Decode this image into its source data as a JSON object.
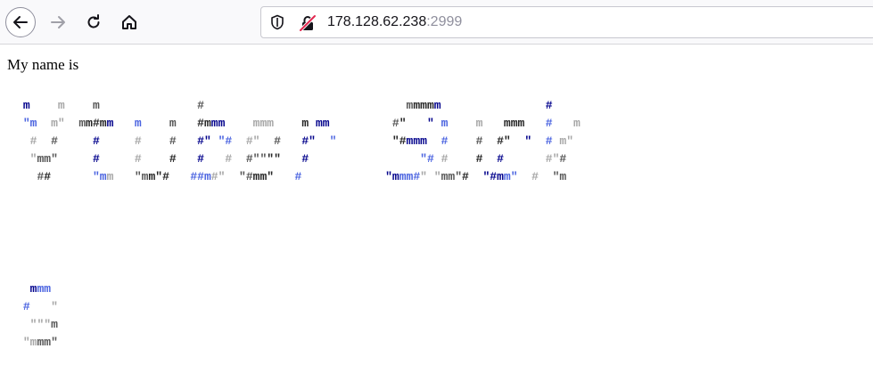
{
  "browser": {
    "icons": {
      "back": "back-arrow-icon",
      "forward": "forward-arrow-icon",
      "reload": "reload-icon",
      "home": "home-icon",
      "tracking": "shield-icon",
      "security": "insecure-lock-icon"
    },
    "url": {
      "host": "178.128.62.238",
      "port": ":2999"
    }
  },
  "page": {
    "intro_text": "My name is",
    "ascii_art_block_1": [
      " m    m    m              #                             mmmmm               #      ",
      " \"m  m\"  mm#mm   m    m   #mmm    mmm    m mm         #\"   \" m    m   mmm   #   m  ",
      "  #  #     #     #    #   #\" \"#  #\"  #   #\"  \"        \"#mmm  #    #  #\"  \"  # m\"   ",
      "  \"mm\"     #     #    #   #   #  #\"\"\"\"   #                \"# #    #  #      #\"#    ",
      "   ##      \"mm   \"mm\"#   ##m#\"  \"#mm\"   #            \"mmm#\" \"mm\"#  \"#mm\"  #  \"m   "
    ],
    "ascii_art_block_2": [
      "  mmm ",
      " #   \"",
      "  \"\"\"m",
      " \"mmm\""
    ]
  },
  "colors": {
    "dark_blue": "#00008b",
    "blue": "#4a63e0",
    "light_gray": "#a6a6a6",
    "gray": "#555555",
    "near_black": "#222222"
  }
}
